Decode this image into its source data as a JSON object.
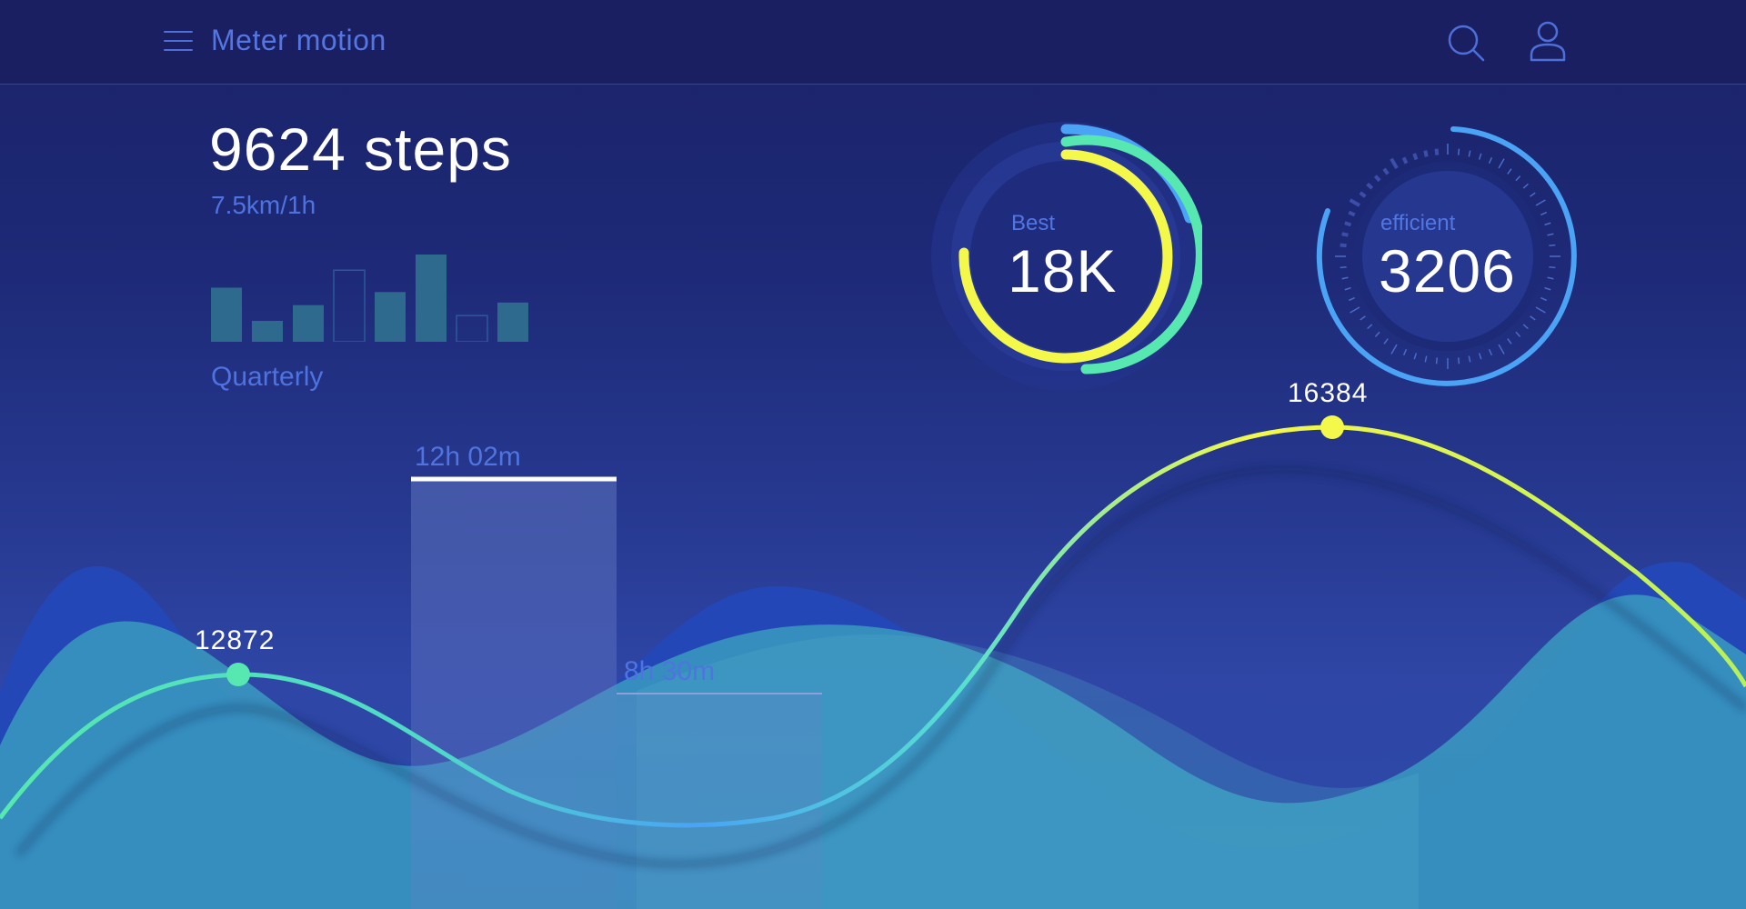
{
  "app": {
    "title": "Meter motion"
  },
  "icons": {
    "menu": "menu-icon",
    "search": "search-icon",
    "user": "user-icon"
  },
  "colors": {
    "background": "#1e2a78",
    "accent_blue": "#4aa3f5",
    "accent_green": "#56e8b0",
    "accent_yellow": "#f4f84a",
    "label_blue": "#4e73e0"
  },
  "summary": {
    "steps": "9624 steps",
    "speed": "7.5km/1h",
    "period": "Quarterly"
  },
  "rings": {
    "best": {
      "label": "Best",
      "value": "18K"
    },
    "efficient": {
      "label": "efficient",
      "value": "3206"
    }
  },
  "durations": [
    {
      "label": "12h 02m"
    },
    {
      "label": "8h 30m"
    }
  ],
  "chart_data": {
    "type": "line",
    "title": "",
    "xlabel": "",
    "ylabel": "",
    "annotations": [
      {
        "label": "12872",
        "value": 12872
      },
      {
        "label": "16384",
        "value": 16384
      }
    ],
    "mini_bars": {
      "type": "bar",
      "values": [
        0.62,
        0.24,
        0.42,
        0.82,
        0.57,
        1.0,
        0.3,
        0.45
      ],
      "highlighted_outline": [
        3,
        6
      ]
    }
  }
}
